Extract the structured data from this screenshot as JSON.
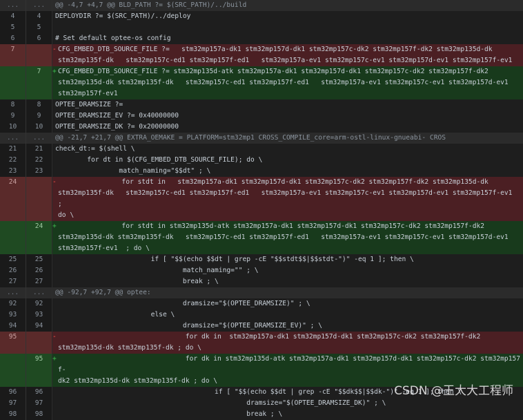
{
  "diff": {
    "rows": [
      {
        "type": "hunk",
        "old": "...",
        "new": "...",
        "text": "@@ -4,7 +4,7 @@ BLD_PATH ?= $(SRC_PATH)/../build"
      },
      {
        "type": "ctx",
        "old": "4",
        "new": "4",
        "text": "DEPLOYDIR ?= $(SRC_PATH)/../deploy"
      },
      {
        "type": "ctx",
        "old": "5",
        "new": "5",
        "text": ""
      },
      {
        "type": "ctx",
        "old": "6",
        "new": "6",
        "text": "# Set default optee-os config"
      },
      {
        "type": "del",
        "old": "7",
        "new": "",
        "text": "CFG_EMBED_DTB_SOURCE_FILE ?=   stm32mp157a-dk1 stm32mp157d-dk1 stm32mp157c-dk2 stm32mp157f-dk2 stm32mp135d-dk\nstm32mp135f-dk   stm32mp157c-ed1 stm32mp157f-ed1   stm32mp157a-ev1 stm32mp157c-ev1 stm32mp157d-ev1 stm32mp157f-ev1"
      },
      {
        "type": "add",
        "old": "",
        "new": "7",
        "text": "CFG_EMBED_DTB_SOURCE_FILE ?= stm32mp135d-atk stm32mp157a-dk1 stm32mp157d-dk1 stm32mp157c-dk2 stm32mp157f-dk2\nstm32mp135d-dk stm32mp135f-dk   stm32mp157c-ed1 stm32mp157f-ed1   stm32mp157a-ev1 stm32mp157c-ev1 stm32mp157d-ev1\nstm32mp157f-ev1"
      },
      {
        "type": "ctx",
        "old": "8",
        "new": "8",
        "text": "OPTEE_DRAMSIZE ?="
      },
      {
        "type": "ctx",
        "old": "9",
        "new": "9",
        "text": "OPTEE_DRAMSIZE_EV ?= 0x40000000"
      },
      {
        "type": "ctx",
        "old": "10",
        "new": "10",
        "text": "OPTEE_DRAMSIZE_DK ?= 0x20000000"
      },
      {
        "type": "hunk",
        "old": "...",
        "new": "...",
        "text": "@@ -21,7 +21,7 @@ EXTRA_OEMAKE = PLATFORM=stm32mp1 CROSS_COMPILE_core=arm-ostl-linux-gnueabi- CROS"
      },
      {
        "type": "ctx",
        "old": "21",
        "new": "21",
        "text": "check_dt:= $(shell \\"
      },
      {
        "type": "ctx",
        "old": "22",
        "new": "22",
        "text": "        for dt in $(CFG_EMBED_DTB_SOURCE_FILE); do \\"
      },
      {
        "type": "ctx",
        "old": "23",
        "new": "23",
        "text": "                match_naming=\"$$dt\" ; \\"
      },
      {
        "type": "del",
        "old": "24",
        "new": "",
        "text": "                for stdt in   stm32mp157a-dk1 stm32mp157d-dk1 stm32mp157c-dk2 stm32mp157f-dk2 stm32mp135d-dk\nstm32mp135f-dk   stm32mp157c-ed1 stm32mp157f-ed1   stm32mp157a-ev1 stm32mp157c-ev1 stm32mp157d-ev1 stm32mp157f-ev1  ;\ndo \\"
      },
      {
        "type": "add",
        "old": "",
        "new": "24",
        "text": "                for stdt in stm32mp135d-atk stm32mp157a-dk1 stm32mp157d-dk1 stm32mp157c-dk2 stm32mp157f-dk2\nstm32mp135d-dk stm32mp135f-dk   stm32mp157c-ed1 stm32mp157f-ed1   stm32mp157a-ev1 stm32mp157c-ev1 stm32mp157d-ev1\nstm32mp157f-ev1  ; do \\"
      },
      {
        "type": "ctx",
        "old": "25",
        "new": "25",
        "text": "                        if [ \"$$(echo $$dt | grep -cE \"$$stdt$$|$$stdt-\")\" -eq 1 ]; then \\"
      },
      {
        "type": "ctx",
        "old": "26",
        "new": "26",
        "text": "                                match_naming=\"\" ; \\"
      },
      {
        "type": "ctx",
        "old": "27",
        "new": "27",
        "text": "                                break ; \\"
      },
      {
        "type": "hunk",
        "old": "...",
        "new": "...",
        "text": "@@ -92,7 +92,7 @@ optee:"
      },
      {
        "type": "ctx",
        "old": "92",
        "new": "92",
        "text": "                                dramsize=\"$(OPTEE_DRAMSIZE)\" ; \\"
      },
      {
        "type": "ctx",
        "old": "93",
        "new": "93",
        "text": "                        else \\"
      },
      {
        "type": "ctx",
        "old": "94",
        "new": "94",
        "text": "                                dramsize=\"$(OPTEE_DRAMSIZE_EV)\" ; \\"
      },
      {
        "type": "del",
        "old": "95",
        "new": "",
        "text": "                                for dk in  stm32mp157a-dk1 stm32mp157d-dk1 stm32mp157c-dk2 stm32mp157f-dk2\nstm32mp135d-dk stm32mp135f-dk ; do \\"
      },
      {
        "type": "add",
        "old": "",
        "new": "95",
        "text": "                                for dk in stm32mp135d-atk stm32mp157a-dk1 stm32mp157d-dk1 stm32mp157c-dk2 stm32mp157f-\ndk2 stm32mp135d-dk stm32mp135f-dk ; do \\"
      },
      {
        "type": "ctx",
        "old": "96",
        "new": "96",
        "text": "                                        if [ \"$$(echo $$dt | grep -cE \"$$dk$$|$$dk-\")\" -eq 1 ]; then \\"
      },
      {
        "type": "ctx",
        "old": "97",
        "new": "97",
        "text": "                                                dramsize=\"$(OPTEE_DRAMSIZE_DK)\" ; \\"
      },
      {
        "type": "ctx",
        "old": "98",
        "new": "98",
        "text": "                                                break ; \\"
      }
    ]
  },
  "watermark": "CSDN @王大大工程师"
}
